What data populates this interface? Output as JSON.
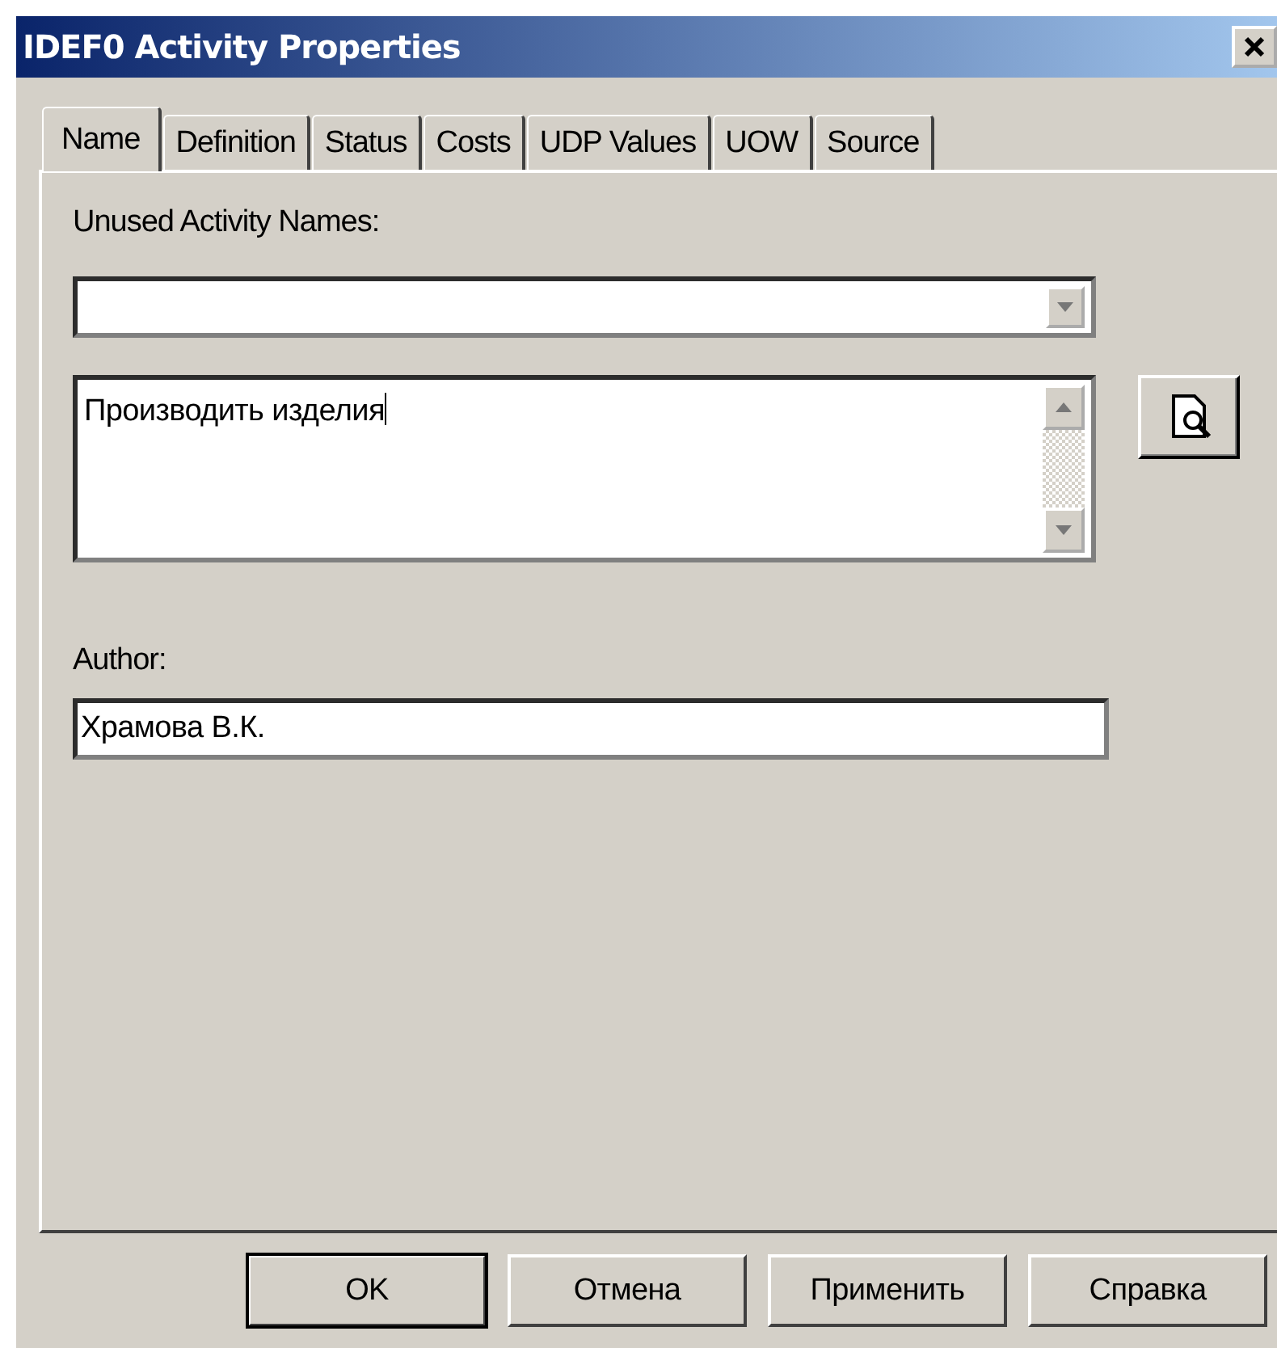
{
  "window": {
    "title": "IDEF0 Activity Properties"
  },
  "tabs": [
    {
      "label": "Name",
      "selected": true
    },
    {
      "label": "Definition",
      "selected": false
    },
    {
      "label": "Status",
      "selected": false
    },
    {
      "label": "Costs",
      "selected": false
    },
    {
      "label": "UDP Values",
      "selected": false
    },
    {
      "label": "UOW",
      "selected": false
    },
    {
      "label": "Source",
      "selected": false
    }
  ],
  "unused_names": {
    "label": "Unused Activity Names:"
  },
  "name_text": {
    "value": "Производить изделия"
  },
  "author": {
    "label": "Author:",
    "value": "Храмова В.К."
  },
  "buttons": [
    {
      "label": "OK",
      "default": true
    },
    {
      "label": "Отмена",
      "default": false
    },
    {
      "label": "Применить",
      "default": false
    },
    {
      "label": "Справка",
      "default": false
    }
  ]
}
